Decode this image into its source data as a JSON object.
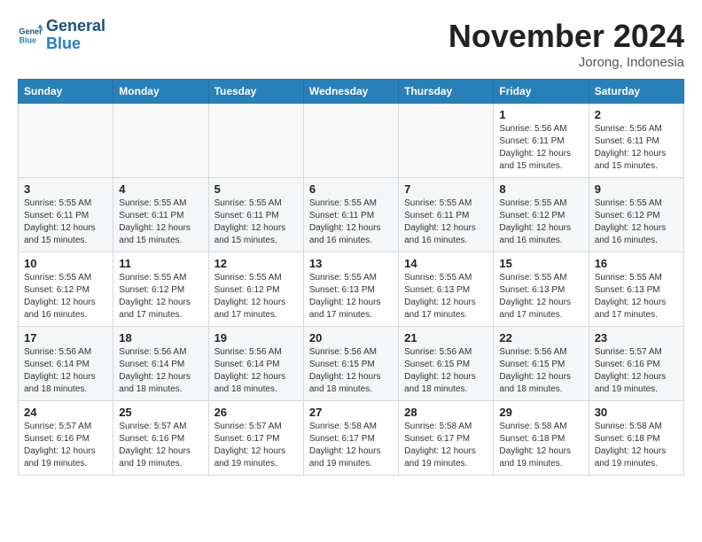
{
  "header": {
    "logo_line1": "General",
    "logo_line2": "Blue",
    "month": "November 2024",
    "location": "Jorong, Indonesia"
  },
  "days_of_week": [
    "Sunday",
    "Monday",
    "Tuesday",
    "Wednesday",
    "Thursday",
    "Friday",
    "Saturday"
  ],
  "weeks": [
    [
      {
        "day": "",
        "info": ""
      },
      {
        "day": "",
        "info": ""
      },
      {
        "day": "",
        "info": ""
      },
      {
        "day": "",
        "info": ""
      },
      {
        "day": "",
        "info": ""
      },
      {
        "day": "1",
        "info": "Sunrise: 5:56 AM\nSunset: 6:11 PM\nDaylight: 12 hours and 15 minutes."
      },
      {
        "day": "2",
        "info": "Sunrise: 5:56 AM\nSunset: 6:11 PM\nDaylight: 12 hours and 15 minutes."
      }
    ],
    [
      {
        "day": "3",
        "info": "Sunrise: 5:55 AM\nSunset: 6:11 PM\nDaylight: 12 hours and 15 minutes."
      },
      {
        "day": "4",
        "info": "Sunrise: 5:55 AM\nSunset: 6:11 PM\nDaylight: 12 hours and 15 minutes."
      },
      {
        "day": "5",
        "info": "Sunrise: 5:55 AM\nSunset: 6:11 PM\nDaylight: 12 hours and 15 minutes."
      },
      {
        "day": "6",
        "info": "Sunrise: 5:55 AM\nSunset: 6:11 PM\nDaylight: 12 hours and 16 minutes."
      },
      {
        "day": "7",
        "info": "Sunrise: 5:55 AM\nSunset: 6:11 PM\nDaylight: 12 hours and 16 minutes."
      },
      {
        "day": "8",
        "info": "Sunrise: 5:55 AM\nSunset: 6:12 PM\nDaylight: 12 hours and 16 minutes."
      },
      {
        "day": "9",
        "info": "Sunrise: 5:55 AM\nSunset: 6:12 PM\nDaylight: 12 hours and 16 minutes."
      }
    ],
    [
      {
        "day": "10",
        "info": "Sunrise: 5:55 AM\nSunset: 6:12 PM\nDaylight: 12 hours and 16 minutes."
      },
      {
        "day": "11",
        "info": "Sunrise: 5:55 AM\nSunset: 6:12 PM\nDaylight: 12 hours and 17 minutes."
      },
      {
        "day": "12",
        "info": "Sunrise: 5:55 AM\nSunset: 6:12 PM\nDaylight: 12 hours and 17 minutes."
      },
      {
        "day": "13",
        "info": "Sunrise: 5:55 AM\nSunset: 6:13 PM\nDaylight: 12 hours and 17 minutes."
      },
      {
        "day": "14",
        "info": "Sunrise: 5:55 AM\nSunset: 6:13 PM\nDaylight: 12 hours and 17 minutes."
      },
      {
        "day": "15",
        "info": "Sunrise: 5:55 AM\nSunset: 6:13 PM\nDaylight: 12 hours and 17 minutes."
      },
      {
        "day": "16",
        "info": "Sunrise: 5:55 AM\nSunset: 6:13 PM\nDaylight: 12 hours and 17 minutes."
      }
    ],
    [
      {
        "day": "17",
        "info": "Sunrise: 5:56 AM\nSunset: 6:14 PM\nDaylight: 12 hours and 18 minutes."
      },
      {
        "day": "18",
        "info": "Sunrise: 5:56 AM\nSunset: 6:14 PM\nDaylight: 12 hours and 18 minutes."
      },
      {
        "day": "19",
        "info": "Sunrise: 5:56 AM\nSunset: 6:14 PM\nDaylight: 12 hours and 18 minutes."
      },
      {
        "day": "20",
        "info": "Sunrise: 5:56 AM\nSunset: 6:15 PM\nDaylight: 12 hours and 18 minutes."
      },
      {
        "day": "21",
        "info": "Sunrise: 5:56 AM\nSunset: 6:15 PM\nDaylight: 12 hours and 18 minutes."
      },
      {
        "day": "22",
        "info": "Sunrise: 5:56 AM\nSunset: 6:15 PM\nDaylight: 12 hours and 18 minutes."
      },
      {
        "day": "23",
        "info": "Sunrise: 5:57 AM\nSunset: 6:16 PM\nDaylight: 12 hours and 19 minutes."
      }
    ],
    [
      {
        "day": "24",
        "info": "Sunrise: 5:57 AM\nSunset: 6:16 PM\nDaylight: 12 hours and 19 minutes."
      },
      {
        "day": "25",
        "info": "Sunrise: 5:57 AM\nSunset: 6:16 PM\nDaylight: 12 hours and 19 minutes."
      },
      {
        "day": "26",
        "info": "Sunrise: 5:57 AM\nSunset: 6:17 PM\nDaylight: 12 hours and 19 minutes."
      },
      {
        "day": "27",
        "info": "Sunrise: 5:58 AM\nSunset: 6:17 PM\nDaylight: 12 hours and 19 minutes."
      },
      {
        "day": "28",
        "info": "Sunrise: 5:58 AM\nSunset: 6:17 PM\nDaylight: 12 hours and 19 minutes."
      },
      {
        "day": "29",
        "info": "Sunrise: 5:58 AM\nSunset: 6:18 PM\nDaylight: 12 hours and 19 minutes."
      },
      {
        "day": "30",
        "info": "Sunrise: 5:58 AM\nSunset: 6:18 PM\nDaylight: 12 hours and 19 minutes."
      }
    ]
  ]
}
